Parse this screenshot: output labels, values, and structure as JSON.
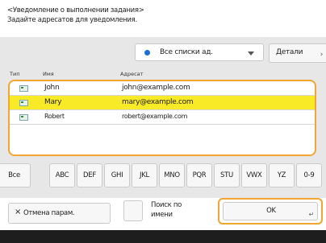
{
  "header": {
    "line1": "<Уведомление о выполнении задания>",
    "line2": "Задайте адресатов для уведомления."
  },
  "filter": {
    "selected": "Все списки ад.",
    "dot_color": "#1b6fd6"
  },
  "details_label": "Детали",
  "table": {
    "columns": {
      "type": "Тип",
      "name": "Имя",
      "address": "Адресат"
    },
    "rows": [
      {
        "name": "John",
        "address": "john@example.com",
        "selected": false
      },
      {
        "name": "Mary",
        "address": "mary@example.com",
        "selected": true
      },
      {
        "name": "Robert",
        "address": "robert@example.com",
        "selected": false
      }
    ]
  },
  "alpha_index": [
    "Все",
    "ABC",
    "DEF",
    "GHI",
    "JKL",
    "MNO",
    "PQR",
    "STU",
    "VWX",
    "YZ",
    "0-9"
  ],
  "bottom": {
    "cancel_label": "Отмена парам.",
    "search_by_name_line1": "Поиск по",
    "search_by_name_line2": "имени",
    "ok_label": "OK"
  },
  "colors": {
    "highlight": "#f8ea26",
    "focus_outline": "#f3a531",
    "panel": "#e7e7e7"
  }
}
